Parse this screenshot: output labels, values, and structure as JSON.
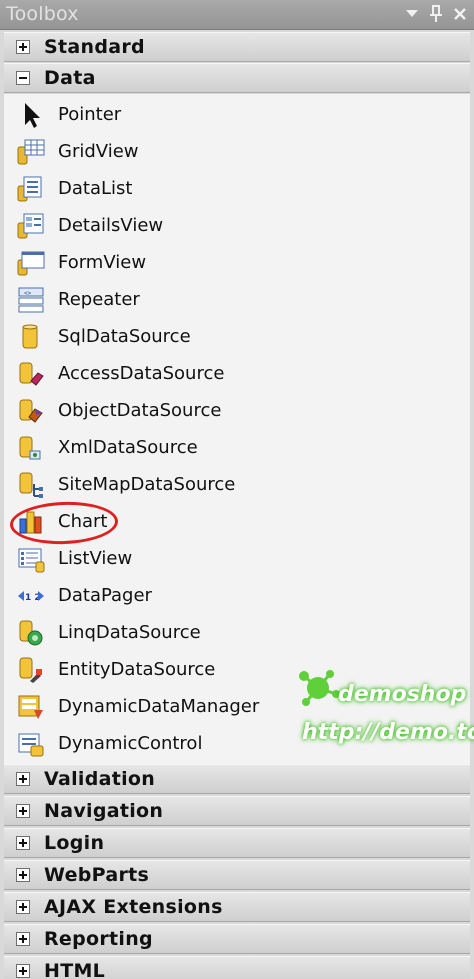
{
  "window": {
    "title": "Toolbox",
    "buttons": [
      "dropdown-arrow-icon",
      "pin-icon",
      "close-icon"
    ]
  },
  "categories_top": [
    {
      "label": "Standard",
      "expanded": false
    },
    {
      "label": "Data",
      "expanded": true
    }
  ],
  "data_items": [
    {
      "label": "Pointer",
      "icon": "pointer-arrow-icon"
    },
    {
      "label": "GridView",
      "icon": "gridview-icon"
    },
    {
      "label": "DataList",
      "icon": "datalist-icon"
    },
    {
      "label": "DetailsView",
      "icon": "detailsview-icon"
    },
    {
      "label": "FormView",
      "icon": "formview-icon"
    },
    {
      "label": "Repeater",
      "icon": "repeater-icon"
    },
    {
      "label": "SqlDataSource",
      "icon": "database-icon"
    },
    {
      "label": "AccessDataSource",
      "icon": "access-datasource-icon"
    },
    {
      "label": "ObjectDataSource",
      "icon": "object-datasource-icon"
    },
    {
      "label": "XmlDataSource",
      "icon": "xml-datasource-icon"
    },
    {
      "label": "SiteMapDataSource",
      "icon": "sitemap-datasource-icon"
    },
    {
      "label": "Chart",
      "icon": "chart-icon"
    },
    {
      "label": "ListView",
      "icon": "listview-icon"
    },
    {
      "label": "DataPager",
      "icon": "datapager-icon"
    },
    {
      "label": "LinqDataSource",
      "icon": "linq-datasource-icon"
    },
    {
      "label": "EntityDataSource",
      "icon": "entity-datasource-icon"
    },
    {
      "label": "DynamicDataManager",
      "icon": "dynamic-data-manager-icon"
    },
    {
      "label": "DynamicControl",
      "icon": "dynamic-control-icon"
    }
  ],
  "categories_bottom": [
    {
      "label": "Validation",
      "expanded": false
    },
    {
      "label": "Navigation",
      "expanded": false
    },
    {
      "label": "Login",
      "expanded": false
    },
    {
      "label": "WebParts",
      "expanded": false
    },
    {
      "label": "AJAX Extensions",
      "expanded": false
    },
    {
      "label": "Reporting",
      "expanded": false
    },
    {
      "label": "HTML",
      "expanded": false
    }
  ],
  "watermark": {
    "brand": "demoshop",
    "url": "http://demo.tc"
  },
  "colors": {
    "highlight": "#e02020",
    "watermark_glow": "#3fbf1f"
  }
}
